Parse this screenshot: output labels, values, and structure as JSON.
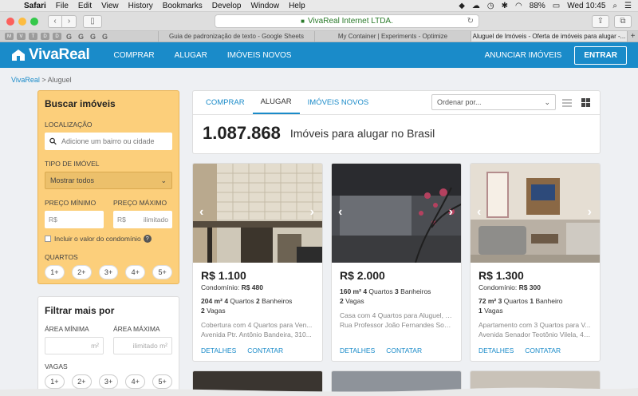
{
  "menubar": {
    "app": "Safari",
    "items": [
      "File",
      "Edit",
      "View",
      "History",
      "Bookmarks",
      "Develop",
      "Window",
      "Help"
    ],
    "battery": "88%",
    "clock": "Wed 10:45"
  },
  "browser": {
    "address": "VivaReal Internet LTDA.",
    "tabs": [
      "Guia de padronização de texto - Google Sheets",
      "My Container | Experiments - Optimize",
      "Aluguel de Imóveis - Oferta de imóveis para alugar -..."
    ]
  },
  "header": {
    "logo": "VivaReal",
    "nav": [
      "COMPRAR",
      "ALUGAR",
      "IMÓVEIS NOVOS"
    ],
    "anunciar": "ANUNCIAR IMÓVEIS",
    "entrar": "ENTRAR",
    "brand_color": "#1a8bc9"
  },
  "breadcrumb": {
    "root": "VivaReal",
    "sep": ">",
    "current": "Aluguel"
  },
  "filters": {
    "title": "Buscar imóveis",
    "location_label": "LOCALIZAÇÃO",
    "location_placeholder": "Adicione um bairro ou cidade",
    "type_label": "TIPO DE IMÓVEL",
    "type_value": "Mostrar todos",
    "min_label": "PREÇO MÍNIMO",
    "max_label": "PREÇO MÁXIMO",
    "currency": "R$",
    "max_placeholder": "ilimitado",
    "condo_check": "Incluir o valor do condomínio",
    "rooms_label": "QUARTOS",
    "rooms": [
      "1+",
      "2+",
      "3+",
      "4+",
      "5+"
    ]
  },
  "more_filters": {
    "title": "Filtrar mais por",
    "area_min_label": "ÁREA MÍNIMA",
    "area_max_label": "ÁREA MÁXIMA",
    "unit": "m²",
    "unlimited": "ilimitado",
    "vagas_label": "VAGAS",
    "vagas": [
      "1+",
      "2+",
      "3+",
      "4+",
      "5+"
    ]
  },
  "main": {
    "tabs": [
      "COMPRAR",
      "ALUGAR",
      "IMÓVEIS NOVOS"
    ],
    "sort_placeholder": "Ordenar por...",
    "count": "1.087.868",
    "count_label": "Imóveis para alugar no Brasil"
  },
  "listings": [
    {
      "price": "R$ 1.100",
      "condo_label": "Condomínio:",
      "condo_value": "R$ 480",
      "area": "204 m²",
      "rooms": "4",
      "rooms_label": "Quartos",
      "baths": "2",
      "baths_label": "Banheiros",
      "parking": "2",
      "parking_label": "Vagas",
      "title": "Cobertura com 4 Quartos para Ven...",
      "address": "Avenida Ptr. Antônio Bandeira, 310...",
      "details": "DETALHES",
      "contact": "CONTATAR"
    },
    {
      "price": "R$ 2.000",
      "condo_label": "",
      "condo_value": "",
      "area": "160 m²",
      "rooms": "4",
      "rooms_label": "Quartos",
      "baths": "3",
      "baths_label": "Banheiros",
      "parking": "2",
      "parking_label": "Vagas",
      "title": "Casa com 4 Quartos para Aluguel, 1...",
      "address": "Rua Professor João Fernandes Soar...",
      "details": "DETALHES",
      "contact": "CONTATAR"
    },
    {
      "price": "R$ 1.300",
      "condo_label": "Condomínio:",
      "condo_value": "R$ 300",
      "area": "72 m²",
      "rooms": "3",
      "rooms_label": "Quartos",
      "baths": "1",
      "baths_label": "Banheiro",
      "parking": "1",
      "parking_label": "Vagas",
      "title": "Apartamento com 3 Quartos para V...",
      "address": "Avenida Senador Teotônio Vilela, 40...",
      "details": "DETALHES",
      "contact": "CONTATAR"
    }
  ]
}
